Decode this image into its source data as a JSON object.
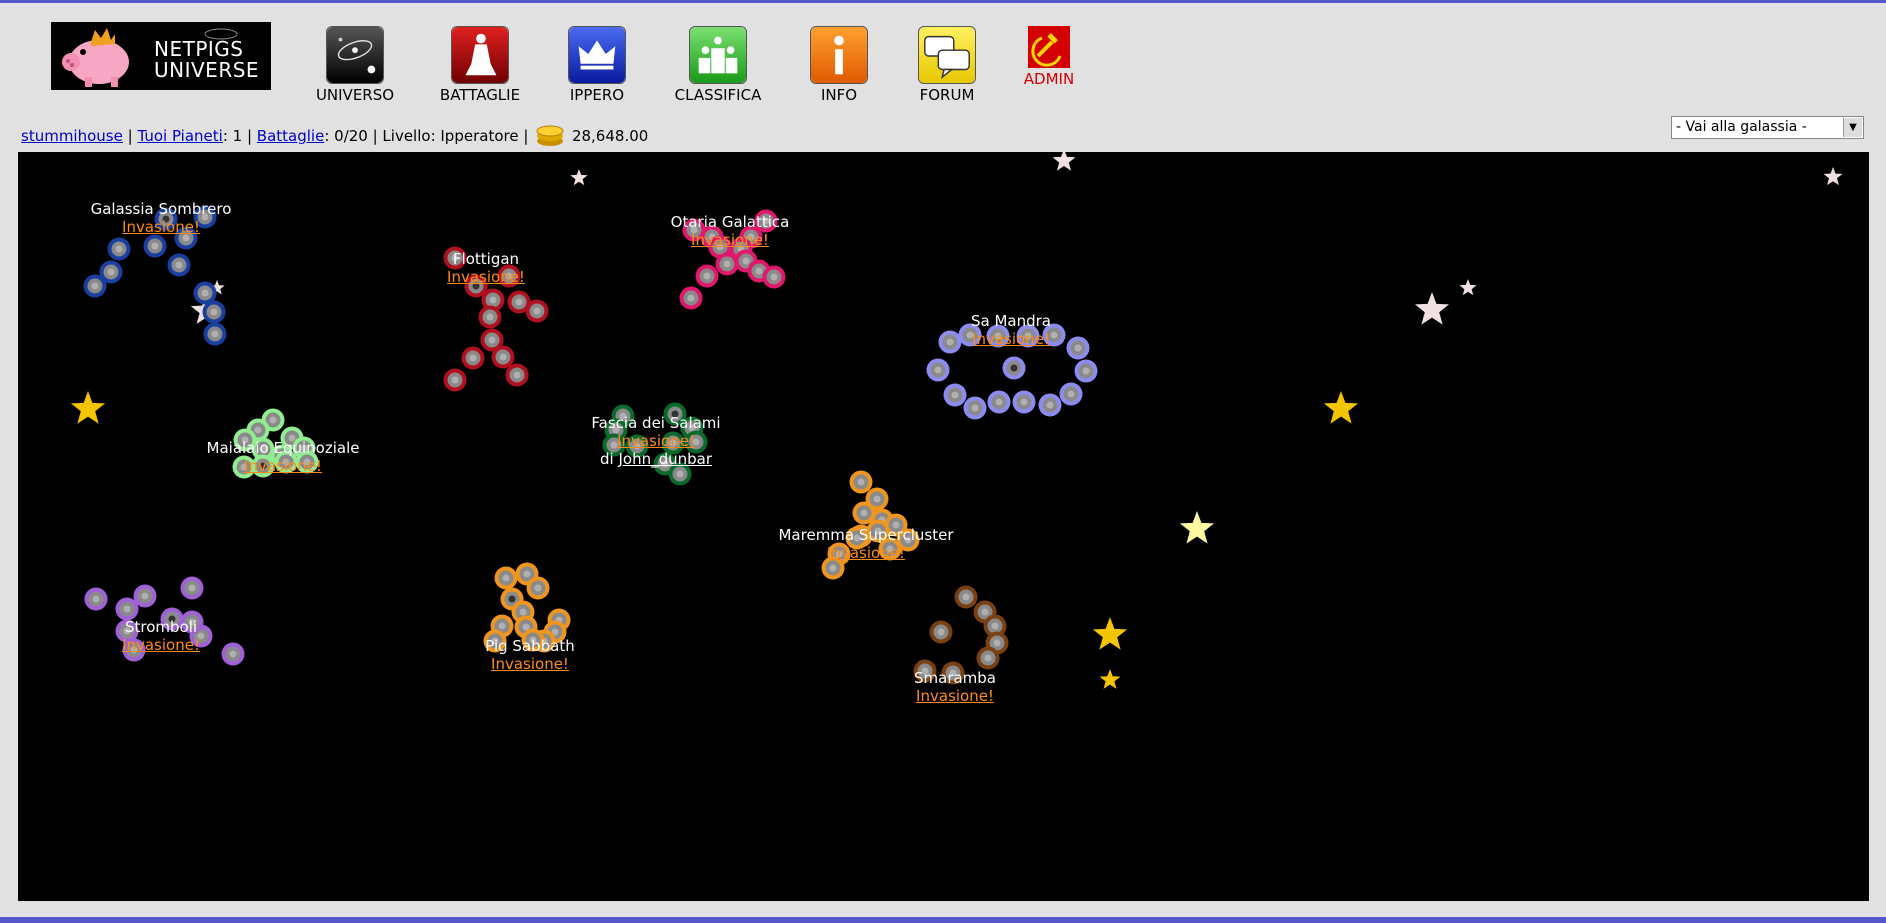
{
  "logo": {
    "line1": "NETPIGS",
    "line2": "UNIVERSE"
  },
  "nav": [
    {
      "label": "UNIVERSO",
      "icon": "galaxy-icon"
    },
    {
      "label": "BATTAGLIE",
      "icon": "fighter-icon"
    },
    {
      "label": "IPPERO",
      "icon": "crown-icon"
    },
    {
      "label": "CLASSIFICA",
      "icon": "podium-icon"
    },
    {
      "label": "INFO",
      "icon": "info-icon"
    },
    {
      "label": "FORUM",
      "icon": "chat-icon"
    },
    {
      "label": "ADMIN",
      "icon": "hammer-sickle-icon"
    }
  ],
  "status": {
    "user": "stummihouse",
    "planets_label": "Tuoi Pianeti",
    "planets_value": ": 1 |",
    "battles_label": "Battaglie",
    "battles_value": ": 0/20 | Livello: Ipperatore |",
    "coins": "28,648.00",
    "sep": "|"
  },
  "galaxy_select": {
    "selected": "- Vai alla galassia -"
  },
  "galaxies": [
    {
      "name": "Galassia Sombrero",
      "action": "Invasione!",
      "color": "#1a3fa0"
    },
    {
      "name": "Flottigan",
      "action": "Invasione!",
      "color": "#b01020"
    },
    {
      "name": "Otaria Galattica",
      "action": "Invasione!",
      "color": "#e0186c"
    },
    {
      "name": "Sa Mandra",
      "action": "Invasione!",
      "color": "#8c8cf0"
    },
    {
      "name": "Maialaio Equinoziale",
      "action": "Invasione!",
      "color": "#90ee90"
    },
    {
      "name": "Fascia dei Salami",
      "action": "Invasione!",
      "owner_prefix": "di",
      "owner": "John_dunbar",
      "color": "#0a6a2a"
    },
    {
      "name": "Maremma Supercluster",
      "action": "Invasione!",
      "color": "#f0961e"
    },
    {
      "name": "Stromboli",
      "action": "Invasione!",
      "color": "#a060d8"
    },
    {
      "name": "Pig Sabbath",
      "action": "Invasione!",
      "color": "#f0961e"
    },
    {
      "name": "Smaramba",
      "action": "Invasione!",
      "color": "#7a4012"
    }
  ]
}
